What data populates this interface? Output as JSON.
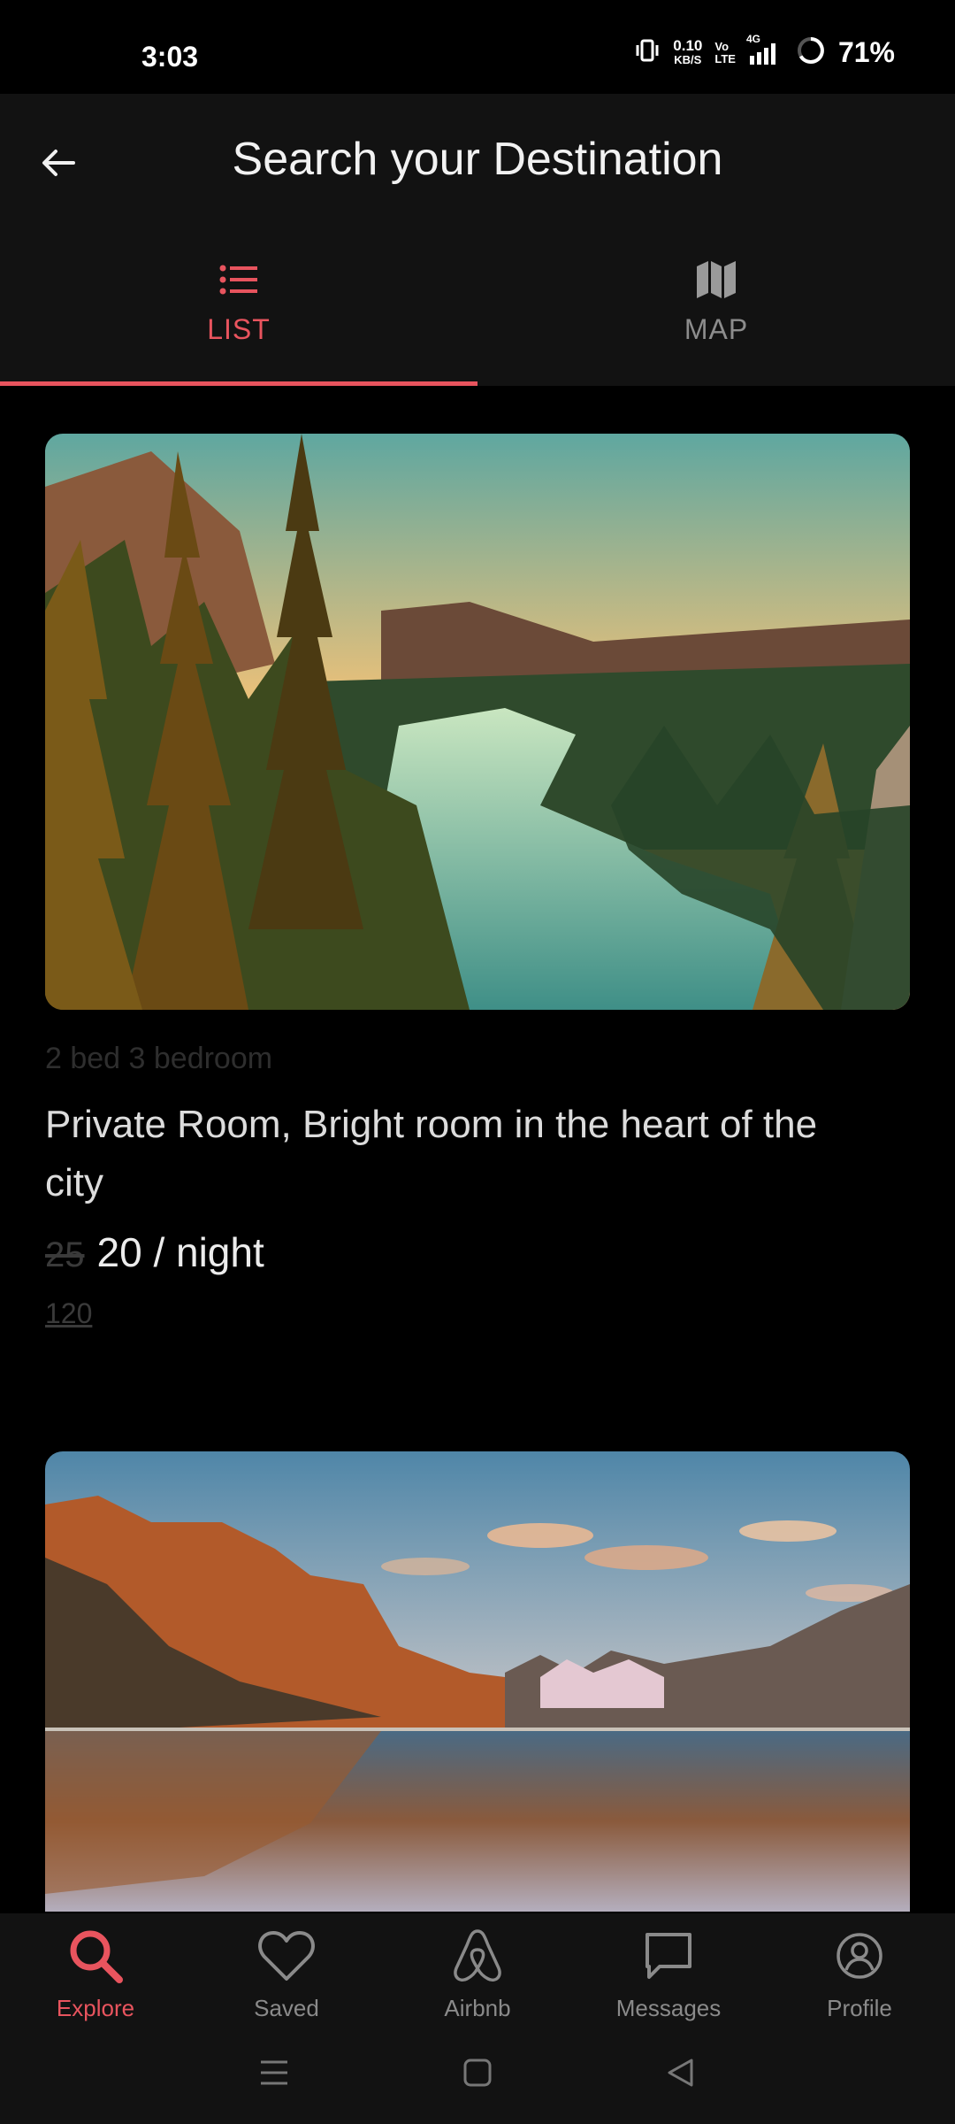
{
  "status_bar": {
    "time": "3:03",
    "speed_value": "0.10",
    "speed_unit": "KB/S",
    "volte_top": "Vo",
    "volte_bottom": "LTE",
    "network": "4G",
    "battery": "71%"
  },
  "app_bar": {
    "title": "Search your Destination",
    "tabs": [
      {
        "label": "LIST",
        "icon": "list-icon",
        "active": true
      },
      {
        "label": "MAP",
        "icon": "map-icon",
        "active": false
      }
    ]
  },
  "listings": [
    {
      "image": "forest-lake-sunset-photo",
      "beds": "2 bed 3 bedroom",
      "title": "Private Room, Bright room in the heart of the city",
      "old_price": "25",
      "new_price": "20 / night",
      "total": "120"
    },
    {
      "image": "mountain-lake-reflection-photo"
    }
  ],
  "bottom_nav": [
    {
      "label": "Explore",
      "icon": "search-icon",
      "active": true
    },
    {
      "label": "Saved",
      "icon": "heart-icon",
      "active": false
    },
    {
      "label": "Airbnb",
      "icon": "airbnb-logo-icon",
      "active": false
    },
    {
      "label": "Messages",
      "icon": "message-icon",
      "active": false
    },
    {
      "label": "Profile",
      "icon": "profile-icon",
      "active": false
    }
  ],
  "colors": {
    "accent": "#e8545e",
    "background": "#000000",
    "bar": "#121212"
  }
}
